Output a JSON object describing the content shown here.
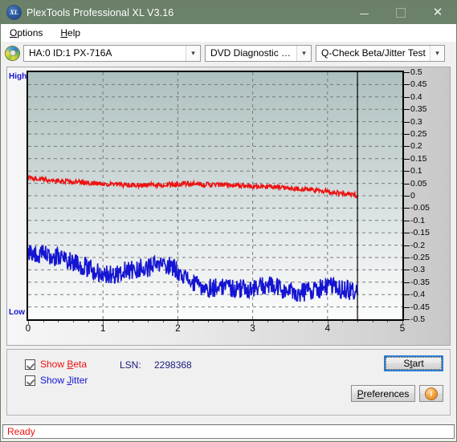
{
  "window": {
    "title": "PlexTools Professional XL V3.16",
    "logo_text": "XL",
    "minimize_label": "—",
    "maximize_label": "",
    "close_label": "✕"
  },
  "menubar": {
    "items": [
      {
        "label": "Options",
        "accel": "O"
      },
      {
        "label": "Help",
        "accel": "H"
      }
    ]
  },
  "toolbar": {
    "drive_select": "HA:0 ID:1  PX-716A",
    "function_select": "DVD Diagnostic Functions",
    "test_select": "Q-Check Beta/Jitter Test",
    "arrow": "⌄"
  },
  "chart_labels": {
    "high": "High",
    "low": "Low"
  },
  "options": {
    "show_beta_label": "Show Beta",
    "show_beta_accel": "B",
    "show_beta_checked": true,
    "show_jitter_label": "Show Jitter",
    "show_jitter_accel": "J",
    "show_jitter_checked": true,
    "lsn_label": "LSN:",
    "lsn_value": "2298368",
    "start_label": "Start",
    "start_accel": "S",
    "preferences_label": "Preferences",
    "preferences_accel": "P",
    "info_label": "i"
  },
  "statusbar": {
    "text": "Ready"
  },
  "colors": {
    "titlebar": "#6b8169",
    "beta_line": "#ee1111",
    "jitter_line": "#1414d2",
    "status_text": "#ee1111",
    "accent_focus": "#2d7dd2"
  },
  "chart_data": {
    "type": "line",
    "title": "Q-Check Beta/Jitter Test",
    "xlabel": "",
    "ylabel": "",
    "xlim": [
      0,
      5
    ],
    "ylim": [
      -0.5,
      0.5
    ],
    "xticks": [
      0,
      1,
      2,
      3,
      4,
      5
    ],
    "yticks": [
      0.5,
      0.45,
      0.4,
      0.35,
      0.3,
      0.25,
      0.2,
      0.15,
      0.1,
      0.05,
      0,
      -0.05,
      -0.1,
      -0.15,
      -0.2,
      -0.25,
      -0.3,
      -0.35,
      -0.4,
      -0.45,
      -0.5
    ],
    "grid": true,
    "legend_position": "external-bottom-left",
    "data_end_x": 4.4,
    "series": [
      {
        "name": "Beta",
        "color": "#ee1111",
        "x": [
          0.0,
          0.1,
          0.2,
          0.3,
          0.4,
          0.5,
          0.6,
          0.7,
          0.8,
          0.9,
          1.0,
          1.1,
          1.2,
          1.3,
          1.4,
          1.5,
          1.6,
          1.7,
          1.8,
          1.9,
          2.0,
          2.1,
          2.2,
          2.3,
          2.4,
          2.5,
          2.6,
          2.7,
          2.8,
          2.9,
          3.0,
          3.1,
          3.2,
          3.3,
          3.4,
          3.5,
          3.6,
          3.7,
          3.8,
          3.9,
          4.0,
          4.1,
          4.2,
          4.3,
          4.4
        ],
        "y": [
          0.072,
          0.07,
          0.066,
          0.063,
          0.061,
          0.058,
          0.056,
          0.054,
          0.052,
          0.05,
          0.048,
          0.046,
          0.045,
          0.043,
          0.042,
          0.042,
          0.043,
          0.044,
          0.044,
          0.045,
          0.047,
          0.048,
          0.047,
          0.046,
          0.045,
          0.044,
          0.043,
          0.042,
          0.041,
          0.04,
          0.039,
          0.038,
          0.037,
          0.035,
          0.033,
          0.031,
          0.029,
          0.026,
          0.023,
          0.02,
          0.017,
          0.013,
          0.01,
          0.006,
          0.002
        ],
        "noise_amplitude": 0.01
      },
      {
        "name": "Jitter",
        "color": "#1414d2",
        "x": [
          0.0,
          0.1,
          0.2,
          0.3,
          0.4,
          0.5,
          0.6,
          0.7,
          0.8,
          0.9,
          1.0,
          1.1,
          1.2,
          1.3,
          1.4,
          1.5,
          1.6,
          1.7,
          1.8,
          1.9,
          2.0,
          2.1,
          2.2,
          2.3,
          2.4,
          2.5,
          2.6,
          2.7,
          2.8,
          2.9,
          3.0,
          3.1,
          3.2,
          3.3,
          3.4,
          3.5,
          3.6,
          3.7,
          3.8,
          3.9,
          4.0,
          4.1,
          4.2,
          4.3,
          4.4
        ],
        "y": [
          -0.225,
          -0.235,
          -0.24,
          -0.245,
          -0.25,
          -0.255,
          -0.265,
          -0.28,
          -0.295,
          -0.305,
          -0.315,
          -0.32,
          -0.315,
          -0.305,
          -0.3,
          -0.295,
          -0.29,
          -0.285,
          -0.28,
          -0.285,
          -0.3,
          -0.33,
          -0.355,
          -0.37,
          -0.375,
          -0.37,
          -0.365,
          -0.37,
          -0.375,
          -0.378,
          -0.375,
          -0.37,
          -0.362,
          -0.37,
          -0.382,
          -0.39,
          -0.392,
          -0.388,
          -0.38,
          -0.375,
          -0.368,
          -0.372,
          -0.38,
          -0.385,
          -0.382
        ],
        "noise_amplitude": 0.04
      }
    ]
  }
}
